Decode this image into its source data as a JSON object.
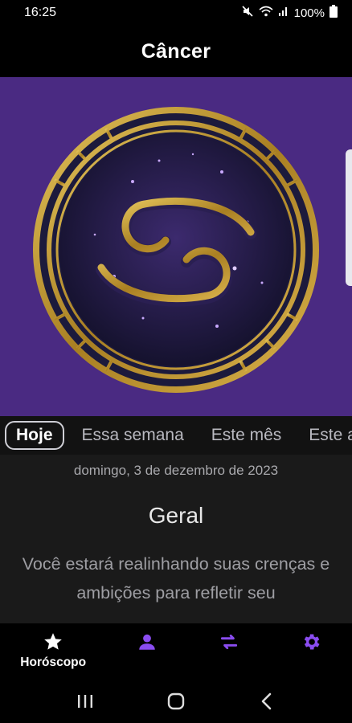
{
  "status_bar": {
    "time": "16:25",
    "battery": "100%",
    "icons": [
      "mute-icon",
      "wifi-icon",
      "signal-icon",
      "battery-icon"
    ]
  },
  "app_bar": {
    "title": "Câncer"
  },
  "hero": {
    "image": "cancer-zodiac-medallion",
    "colors": {
      "background": "#4a2a82",
      "gold": "#b8902a",
      "dark": "#1a1638"
    }
  },
  "tabs": [
    {
      "label": "Hoje",
      "active": true
    },
    {
      "label": "Essa semana",
      "active": false
    },
    {
      "label": "Este mês",
      "active": false
    },
    {
      "label": "Este a",
      "active": false
    }
  ],
  "content": {
    "date": "domingo, 3 de dezembro de 2023",
    "section_title": "Geral",
    "text": "Você estará realinhando suas crenças e ambições para refletir seu"
  },
  "bottom_nav": {
    "items": [
      {
        "icon": "star-icon",
        "label": "Horóscopo",
        "active": true
      },
      {
        "icon": "person-icon",
        "label": ""
      },
      {
        "icon": "swap-icon",
        "label": ""
      },
      {
        "icon": "settings-icon",
        "label": ""
      }
    ],
    "accent": "#8a4cf0"
  },
  "system_nav": {
    "icons": [
      "recents-icon",
      "home-icon",
      "back-icon"
    ]
  }
}
